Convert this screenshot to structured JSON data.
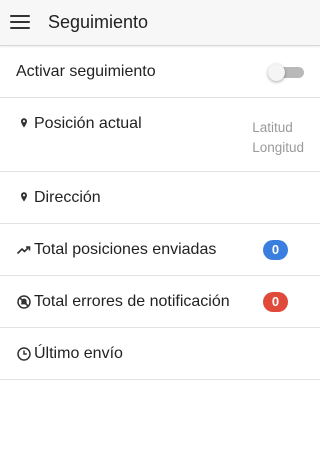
{
  "header": {
    "title": "Seguimiento",
    "menu_icon": "hamburger-menu-icon"
  },
  "rows": {
    "tracking": {
      "label": "Activar seguimiento",
      "toggle_on": false
    },
    "position": {
      "label": "Posición actual",
      "icon": "map-pin-icon",
      "latitude_label": "Latitud",
      "longitude_label": "Longitud"
    },
    "address": {
      "label": "Dirección",
      "icon": "map-pin-icon"
    },
    "sent": {
      "label": "Total posiciones enviadas",
      "icon": "trending-up-icon",
      "count": "0",
      "badge_color": "#3a7fe0"
    },
    "errors": {
      "label": "Total errores de notificación",
      "icon": "no-notification-icon",
      "count": "0",
      "badge_color": "#e04a3a"
    },
    "last_sent": {
      "label": "Último envío",
      "icon": "clock-icon"
    }
  },
  "colors": {
    "app_bar_bg": "#f7f7f7",
    "divider": "#e2e2e2",
    "secondary_text": "#9a9a9a"
  }
}
